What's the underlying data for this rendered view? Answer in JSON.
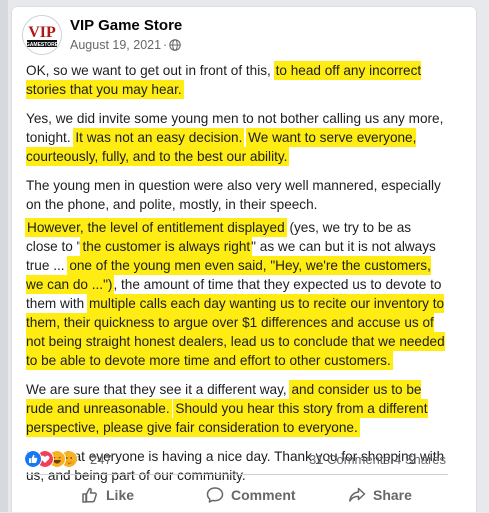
{
  "post": {
    "page_name": "VIP Game Store",
    "date": "August 19, 2021",
    "audience_icon": "globe-icon",
    "avatar": {
      "logo_text": "VIP",
      "sub_text": "GAMESTORE"
    },
    "paragraphs": [
      [
        {
          "t": "OK, so we want to get out in front of this, ",
          "h": false
        },
        {
          "t": "to head off any incorrect stories that you may hear.",
          "h": true
        }
      ],
      [
        {
          "t": "Yes, we did invite some young men to not bother calling us any more, tonight. ",
          "h": false
        },
        {
          "t": "It was not an easy decision.",
          "h": true
        },
        {
          "t": " ",
          "h": false
        },
        {
          "t": "We want to serve everyone, courteously, fully, and to the best our ability.",
          "h": true
        }
      ],
      [
        {
          "t": "The young men in question were also very well mannered, especially on the phone, and polite, mostly, in their speech.",
          "h": false
        }
      ],
      [
        {
          "t": "However, the level of entitlement displayed",
          "h": true
        },
        {
          "t": " (yes, we try to be as close to \"",
          "h": false
        },
        {
          "t": "the customer is always right",
          "h": true
        },
        {
          "t": "\" as we can but it is not always true ... ",
          "h": false
        },
        {
          "t": "one of the young men even said, \"Hey, we're the customers, we can do ...\")",
          "h": true
        },
        {
          "t": ", the amount of time that they expected us to devote to them with ",
          "h": false
        },
        {
          "t": "multiple calls each day wanting us to recite our inventory to them, their quickness to argue over $1 differences and accuse us of not being straight honest dealers, lead us to conclude that we needed to be able to devote more time and effort to other customers.",
          "h": true
        }
      ],
      [
        {
          "t": "We are sure that they see it a different way, ",
          "h": false
        },
        {
          "t": "and consider us to be rude and unreasonable.",
          "h": true
        },
        {
          "t": " ",
          "h": false
        },
        {
          "t": "Should you hear this story from a different perspective, please give fair consideration to everyone.",
          "h": true
        }
      ],
      [
        {
          "t": "Hope that everyone is having a nice day.  Thank you for shopping with us, and being part of our community.",
          "h": false
        }
      ]
    ]
  },
  "stats": {
    "reaction_count": "247",
    "comments": "31 Comments",
    "shares": "4 Shares",
    "reaction_icons": [
      "like-icon",
      "love-icon",
      "haha-icon",
      "care-icon"
    ]
  },
  "actions": {
    "like_label": "Like",
    "comment_label": "Comment",
    "share_label": "Share"
  },
  "colors": {
    "highlight": "#ffec12",
    "like_blue": "#1877f2",
    "love_red": "#f33e58",
    "haha_yellow": "#f7b125"
  }
}
